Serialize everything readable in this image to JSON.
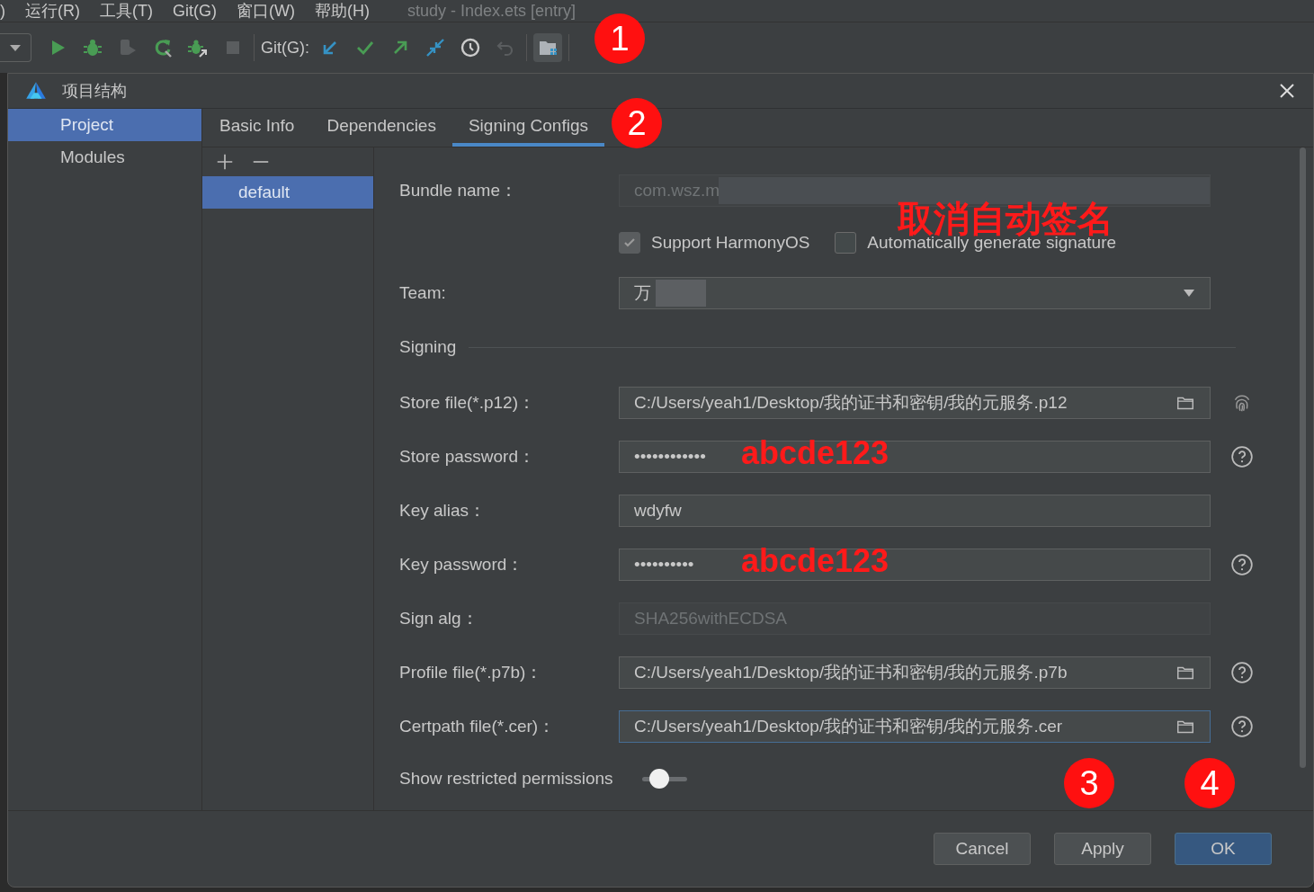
{
  "menu_bar": {
    "items": [
      ")",
      "运行(R)",
      "工具(T)",
      "Git(G)",
      "窗口(W)",
      "帮助(H)"
    ],
    "title": "study - Index.ets [entry]"
  },
  "toolbar": {
    "git_label": "Git(G):",
    "marker": "1"
  },
  "dialog": {
    "title": "项目结构"
  },
  "sidebar": {
    "items": [
      {
        "label": "Project",
        "selected": true
      },
      {
        "label": "Modules",
        "selected": false
      }
    ]
  },
  "tabs": [
    {
      "label": "Basic Info",
      "selected": false
    },
    {
      "label": "Dependencies",
      "selected": false
    },
    {
      "label": "Signing Configs",
      "selected": true,
      "marker": "2"
    }
  ],
  "configs": [
    {
      "label": "default",
      "selected": true
    }
  ],
  "form": [
    {
      "kind": "field",
      "label": "Bundle name：",
      "value": "com.wsz.m",
      "disabled": true,
      "redacted": true
    },
    {
      "kind": "checkboxes",
      "note": "取消自动签名",
      "items": [
        {
          "label": "Support HarmonyOS",
          "checked": true,
          "disabled": true
        },
        {
          "label": "Automatically generate signature",
          "checked": false,
          "disabled": false
        }
      ]
    },
    {
      "kind": "select",
      "label": "Team:",
      "value": "万",
      "redacted": true
    },
    {
      "kind": "section",
      "label": "Signing"
    },
    {
      "kind": "field",
      "label": "Store file(*.p12)：",
      "value": "C:/Users/yeah1/Desktop/我的证书和密钥/我的元服务.p12",
      "browse": true,
      "fingerprint_button": true
    },
    {
      "kind": "field",
      "label": "Store password：",
      "value": "••••••••••••",
      "note": "abcde123",
      "help_button": true
    },
    {
      "kind": "field",
      "label": "Key alias：",
      "value": "wdyfw"
    },
    {
      "kind": "field",
      "label": "Key password：",
      "value": "••••••••••",
      "note": "abcde123",
      "help_button": true
    },
    {
      "kind": "field",
      "label": "Sign alg：",
      "value": "SHA256withECDSA",
      "disabled": true
    },
    {
      "kind": "field",
      "label": "Profile file(*.p7b)：",
      "value": "C:/Users/yeah1/Desktop/我的证书和密钥/我的元服务.p7b",
      "browse": true,
      "help_button": true
    },
    {
      "kind": "field",
      "label": "Certpath file(*.cer)：",
      "value": "C:/Users/yeah1/Desktop/我的证书和密钥/我的元服务.cer",
      "browse": true,
      "help_button": true,
      "focused": true
    },
    {
      "kind": "toggle",
      "label": "Show restricted permissions",
      "on": false
    }
  ],
  "buttons": [
    {
      "label": "Cancel",
      "kind": "normal"
    },
    {
      "label": "Apply",
      "kind": "normal",
      "marker": "3"
    },
    {
      "label": "OK",
      "kind": "primary",
      "marker": "4"
    }
  ]
}
